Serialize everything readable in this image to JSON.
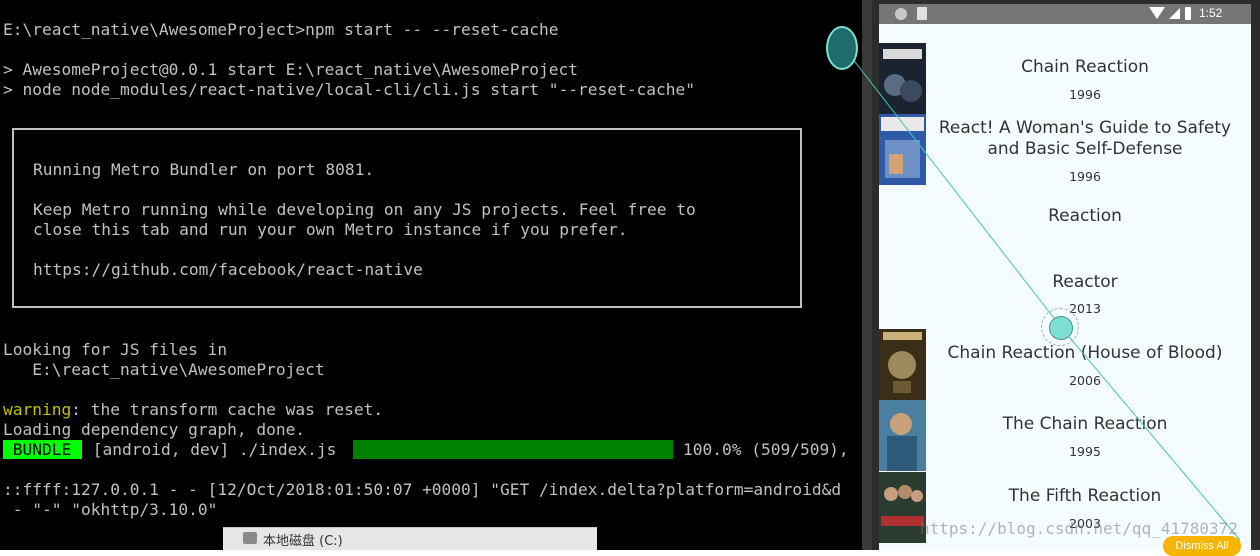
{
  "terminal": {
    "prompt_line": "E:\\react_native\\AwesomeProject>npm start -- --reset-cache",
    "run_line_1": "> AwesomeProject@0.0.1 start E:\\react_native\\AwesomeProject",
    "run_line_2": "> node node_modules/react-native/local-cli/cli.js start \"--reset-cache\"",
    "box_line_1": "Running Metro Bundler on port 8081.",
    "box_line_2": "Keep Metro running while developing on any JS projects. Feel free to",
    "box_line_3": "close this tab and run your own Metro instance if you prefer.",
    "box_line_4": "https://github.com/facebook/react-native",
    "looking_line": "Looking for JS files in",
    "looking_path": "   E:\\react_native\\AwesomeProject",
    "warning_label": "warning",
    "warning_text": ": the transform cache was reset.",
    "loading_line": "Loading dependency graph, done.",
    "bundle_label": " BUNDLE ",
    "bundle_target": " [android, dev] ./index.js ",
    "bundle_progress": "100.0% (509/509),",
    "bundle_progress_value": 1.0,
    "log_line_1": "::ffff:127.0.0.1 - - [12/Oct/2018:01:50:07 +0000] \"GET /index.delta?platform=android&d",
    "log_line_2": " - \"-\" \"okhttp/3.10.0\""
  },
  "taskbar": {
    "drive_label": "本地磁盘 (C:)"
  },
  "statusbar": {
    "time": "1:52"
  },
  "movies": [
    {
      "title": "Chain Reaction",
      "year": "1996",
      "poster": "chain-reaction-poster"
    },
    {
      "title": "React! A Woman's Guide to Safety and Basic Self-Defense",
      "year": "1996",
      "poster": "react-guide-poster"
    },
    {
      "title": "Reaction",
      "year": "",
      "poster": ""
    },
    {
      "title": "Reactor",
      "year": "2013",
      "poster": ""
    },
    {
      "title": "Chain Reaction (House of Blood)",
      "year": "2006",
      "poster": "house-of-blood-poster"
    },
    {
      "title": "The Chain Reaction",
      "year": "1995",
      "poster": "the-chain-reaction-poster"
    },
    {
      "title": "The Fifth Reaction",
      "year": "2003",
      "poster": "fifth-reaction-poster"
    }
  ],
  "dismiss_label": "Dismiss All",
  "watermark": "https://blog.csdn.net/qq_41780372",
  "colors": {
    "accent": "#7fded2",
    "progress": "#008000",
    "bundle": "#00ff00",
    "warning": "#c0c000"
  }
}
